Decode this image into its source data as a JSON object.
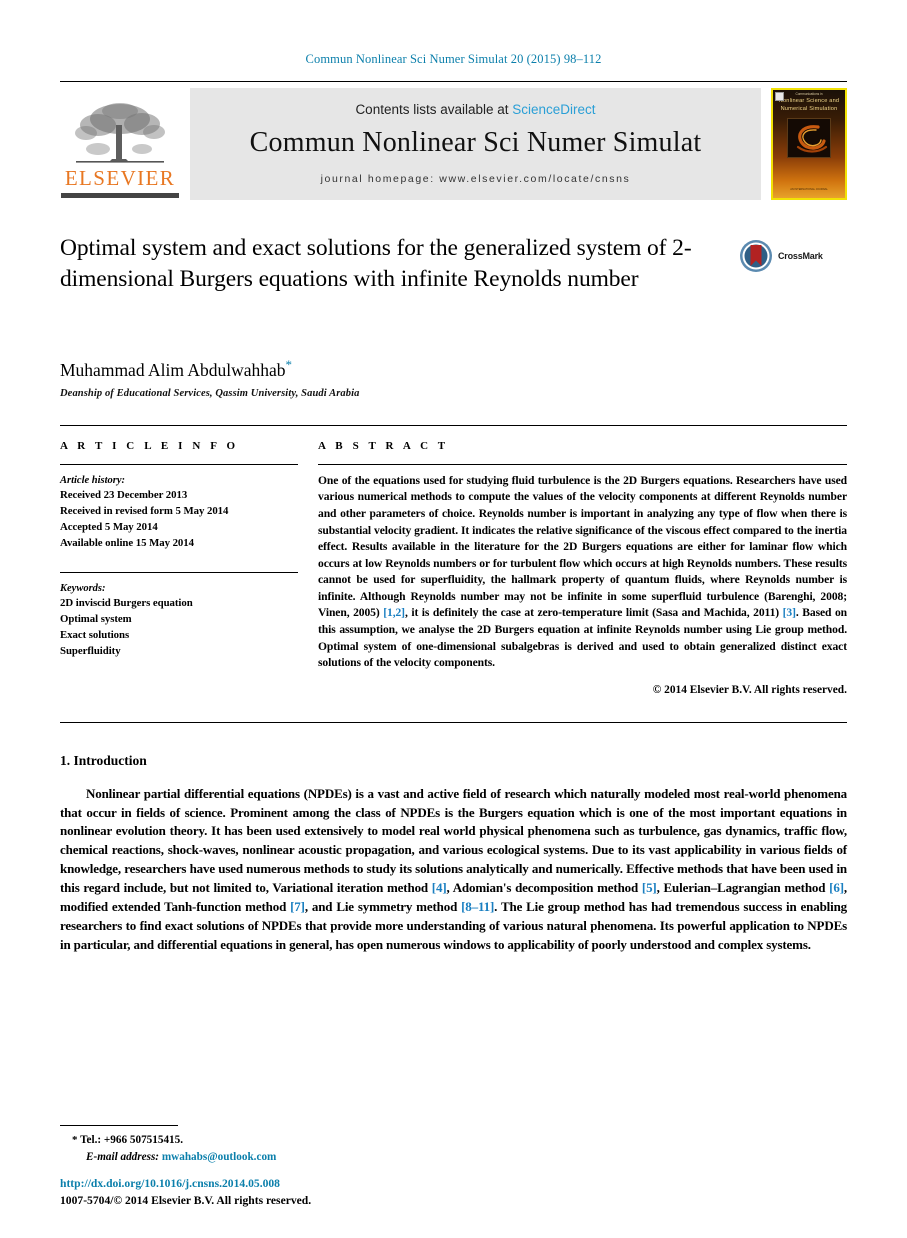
{
  "running_head": "Commun Nonlinear Sci Numer Simulat 20 (2015) 98–112",
  "masthead": {
    "publisher_logo_text": "ELSEVIER",
    "contents_prefix": "Contents lists available at ",
    "contents_link": "ScienceDirect",
    "journal_title": "Commun Nonlinear Sci Numer Simulat",
    "homepage": "journal homepage: www.elsevier.com/locate/cnsns",
    "cover": {
      "publisher_line": "Communications in",
      "title_line_1": "Nonlinear Science and",
      "title_line_2": "Numerical Simulation",
      "footer": "AN INTERNATIONAL JOURNAL"
    }
  },
  "article": {
    "title": "Optimal system and exact solutions for the generalized system of 2-dimensional Burgers equations with infinite Reynolds number",
    "crossmark_label": "CrossMark",
    "author": "Muhammad Alim Abdulwahhab",
    "author_marker": "*",
    "affiliation": "Deanship of Educational Services, Qassim University, Saudi Arabia"
  },
  "info": {
    "heading": "A R T I C L E   I N F O",
    "history_label": "Article history:",
    "history": [
      "Received 23 December 2013",
      "Received in revised form 5 May 2014",
      "Accepted 5 May 2014",
      "Available online 15 May 2014"
    ],
    "keywords_label": "Keywords:",
    "keywords": [
      "2D inviscid Burgers equation",
      "Optimal system",
      "Exact solutions",
      "Superfluidity"
    ]
  },
  "abstract": {
    "heading": "A B S T R A C T",
    "part_1": "One of the equations used for studying fluid turbulence is the 2D Burgers equations. Researchers have used various numerical methods to compute the values of the velocity components at different Reynolds number and other parameters of choice. Reynolds number is important in analyzing any type of flow when there is substantial velocity gradient. It indicates the relative significance of the viscous effect compared to the inertia effect. Results available in the literature for the 2D Burgers equations are either for laminar flow which occurs at low Reynolds numbers or for turbulent flow which occurs at high Reynolds numbers. These results cannot be used for superfluidity, the hallmark property of quantum fluids, where Reynolds number is infinite. Although Reynolds number may not be infinite in some superfluid turbulence (Barenghi, 2008; Vinen, 2005) ",
    "ref_1": "[1,2]",
    "part_2": ", it is definitely the case at zero-temperature limit (Sasa and Machida, 2011) ",
    "ref_2": "[3]",
    "part_3": ". Based on this assumption, we analyse the 2D Burgers equation at infinite Reynolds number using Lie group method. Optimal system of one-dimensional subalgebras is derived and used to obtain generalized distinct exact solutions of the velocity components.",
    "copyright": "© 2014 Elsevier B.V. All rights reserved."
  },
  "introduction": {
    "section_title": "1. Introduction",
    "p1_a": "Nonlinear partial differential equations (NPDEs) is a vast and active field of research which naturally modeled most real-world phenomena that occur in fields of science. Prominent among the class of NPDEs is the Burgers equation which is one of the most important equations in nonlinear evolution theory. It has been used extensively to model real world physical phenomena such as turbulence, gas dynamics, traffic flow, chemical reactions, shock-waves, nonlinear acoustic propagation, and various ecological systems. Due to its vast applicability in various fields of knowledge, researchers have used numerous methods to study its solutions analytically and numerically. Effective methods that have been used in this regard include, but not limited to, Variational iteration method ",
    "ref_4": "[4]",
    "p1_b": ", Adomian's decomposition method ",
    "ref_5": "[5]",
    "p1_c": ", Eulerian–Lagrangian method ",
    "ref_6": "[6]",
    "p1_d": ", modified extended Tanh-function method ",
    "ref_7": "[7]",
    "p1_e": ", and Lie symmetry method ",
    "ref_8": "[8–11]",
    "p1_f": ". The Lie group method has had tremendous success in enabling researchers to find exact solutions of NPDEs that provide more understanding of various natural phenomena. Its powerful application to NPDEs in particular, and differential equations in general, has open numerous windows to applicability of poorly understood and complex systems."
  },
  "footnotes": {
    "tel_marker": "*",
    "tel": "Tel.: +966 507515415.",
    "email_label": "E-mail address:",
    "email": "mwahabs@outlook.com",
    "doi": "http://dx.doi.org/10.1016/j.cnsns.2014.05.008",
    "issn": "1007-5704/© 2014 Elsevier B.V. All rights reserved."
  },
  "colors": {
    "link": "#0b7fab",
    "reference": "#1a7fc1",
    "elsevier_orange": "#E87722",
    "sciencedirect": "#2a9fd6",
    "band_gray": "#e6e6e6",
    "cover_border": "#f2e205"
  }
}
